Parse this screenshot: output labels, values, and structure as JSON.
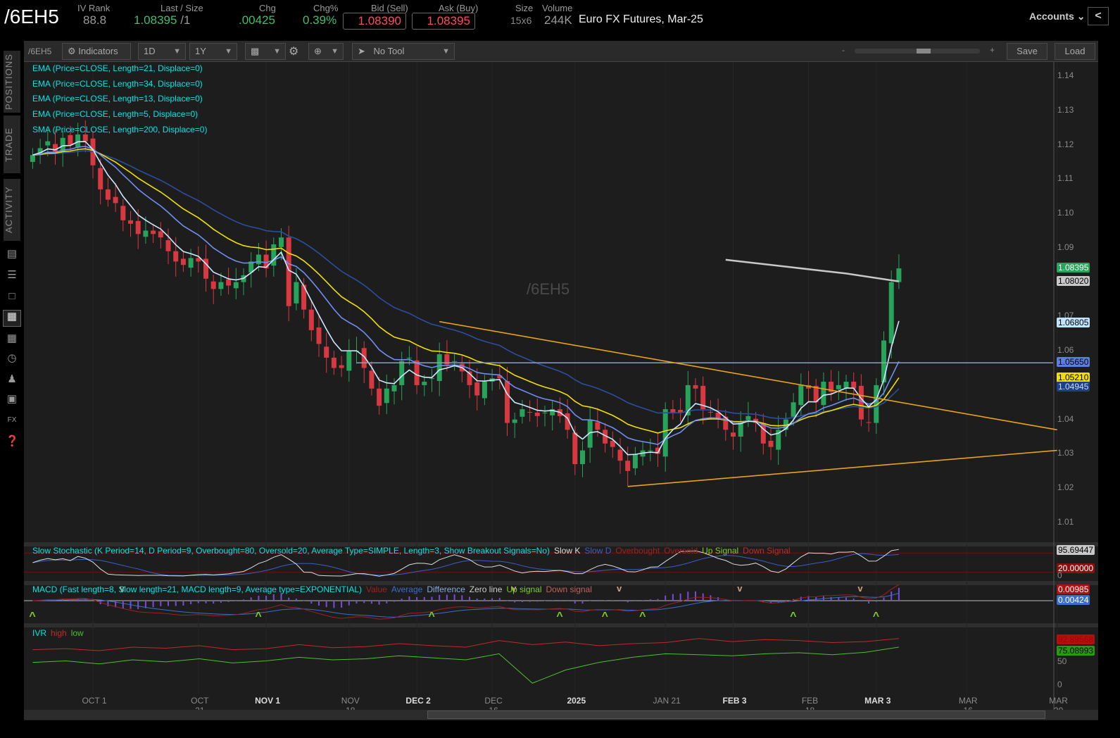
{
  "header": {
    "symbol": "/6EH5",
    "iv_rank_label": "IV Rank",
    "iv_rank": "88.8",
    "last_label": "Last / Size",
    "last": "1.08395",
    "size": "/1",
    "chg_label": "Chg",
    "chg": ".00425",
    "chgpct_label": "Chg%",
    "chgpct": "0.39%",
    "bid_label": "Bid (Sell)",
    "bid": "1.08390",
    "ask_label": "Ask (Buy)",
    "ask": "1.08395",
    "size_label": "Size",
    "size_val": "15x6",
    "volume_label": "Volume",
    "volume": "244K",
    "description": "Euro FX Futures, Mar-25",
    "accounts": "Accounts"
  },
  "toolbar": {
    "symbol": "/6EH5",
    "indicators": "Indicators",
    "aggregation": "1D",
    "timeframe": "1Y",
    "tool": "No Tool",
    "zoom_minus": "-",
    "zoom_plus": "+",
    "zoom_fraction": 0.55,
    "save": "Save",
    "load": "Load"
  },
  "sidebar": {
    "tabs": [
      "POSITIONS",
      "TRADE",
      "ACTIVITY"
    ],
    "icons": [
      "monitor-icon",
      "list-icon",
      "tv-icon",
      "chart-grid-icon",
      "grid-icon",
      "gauge-icon",
      "people-icon",
      "calendar-icon",
      "fx-icon",
      "help-icon"
    ]
  },
  "studies": [
    "EMA (Price=CLOSE, Length=21, Displace=0)",
    "EMA (Price=CLOSE, Length=34, Displace=0)",
    "EMA (Price=CLOSE, Length=13, Displace=0)",
    "EMA (Price=CLOSE, Length=5, Displace=0)",
    "SMA (Price=CLOSE, Length=200, Displace=0)"
  ],
  "watermark": "/6EH5",
  "colors": {
    "up": "#27a35a",
    "down": "#d8383f",
    "ema21": "#f0e000",
    "ema34": "#2a4f9e",
    "ema13": "#6f8ff0",
    "ema5": "#cde9ff",
    "sma200": "#c8c8c8",
    "trend": "#e8a317",
    "hline": "#8aa0c8"
  },
  "chart_data": {
    "type": "candlestick",
    "title": "/6EH5 Daily",
    "ylim": [
      1.005,
      1.145
    ],
    "yticks": [
      "1.01",
      "1.02",
      "1.03",
      "1.04",
      "1.05",
      "1.06",
      "1.07",
      "1.08",
      "1.09",
      "1.10",
      "1.11",
      "1.12",
      "1.13",
      "1.14"
    ],
    "xticks": [
      {
        "label": "OCT 1",
        "i": 8
      },
      {
        "label": "OCT 21",
        "i": 22
      },
      {
        "label": "NOV 1",
        "i": 31
      },
      {
        "label": "NOV 18",
        "i": 42
      },
      {
        "label": "DEC 2",
        "i": 51
      },
      {
        "label": "DEC 16",
        "i": 61
      },
      {
        "label": "2025",
        "i": 72
      },
      {
        "label": "JAN 21",
        "i": 84
      },
      {
        "label": "FEB 3",
        "i": 93
      },
      {
        "label": "FEB 18",
        "i": 103
      },
      {
        "label": "MAR 3",
        "i": 112
      },
      {
        "label": "MAR 16",
        "i": 124
      },
      {
        "label": "MAR 30",
        "i": 136
      }
    ],
    "closes": [
      1.117,
      1.119,
      1.121,
      1.118,
      1.122,
      1.12,
      1.123,
      1.121,
      1.114,
      1.107,
      1.104,
      1.103,
      1.098,
      1.097,
      1.094,
      1.095,
      1.094,
      1.093,
      1.089,
      1.086,
      1.085,
      1.087,
      1.086,
      1.081,
      1.078,
      1.08,
      1.079,
      1.08,
      1.082,
      1.086,
      1.088,
      1.084,
      1.091,
      1.093,
      1.073,
      1.08,
      1.072,
      1.066,
      1.062,
      1.058,
      1.055,
      1.055,
      1.06,
      1.06,
      1.055,
      1.049,
      1.044,
      1.049,
      1.05,
      1.057,
      1.058,
      1.05,
      1.051,
      1.052,
      1.059,
      1.056,
      1.057,
      1.054,
      1.05,
      1.047,
      1.051,
      1.052,
      1.052,
      1.039,
      1.04,
      1.043,
      1.042,
      1.041,
      1.042,
      1.043,
      1.041,
      1.037,
      1.027,
      1.031,
      1.04,
      1.037,
      1.033,
      1.032,
      1.028,
      1.025,
      1.03,
      1.031,
      1.031,
      1.03,
      1.043,
      1.042,
      1.042,
      1.05,
      1.049,
      1.043,
      1.042,
      1.04,
      1.037,
      1.035,
      1.039,
      1.041,
      1.039,
      1.033,
      1.032,
      1.037,
      1.04,
      1.045,
      1.05,
      1.049,
      1.045,
      1.051,
      1.048,
      1.05,
      1.051,
      1.049,
      1.04,
      1.039,
      1.05,
      1.063,
      1.08,
      1.084
    ],
    "sma200": [
      [
        92,
        1.0865
      ],
      [
        100,
        1.0845
      ],
      [
        108,
        1.0825
      ],
      [
        115,
        1.0802
      ]
    ],
    "hline": {
      "price": 1.0565,
      "from": 43
    },
    "trendlines": [
      {
        "from": [
          54,
          1.0685
        ],
        "to": [
          136,
          1.037
        ]
      },
      {
        "from": [
          79,
          1.0205
        ],
        "to": [
          136,
          1.031
        ]
      }
    ],
    "price_tags": [
      {
        "v": "1.08395",
        "bg": "#27a35a",
        "fg": "#fff",
        "p": 1.08395
      },
      {
        "v": "1.08020",
        "bg": "#c8c8c8",
        "fg": "#000",
        "p": 1.0802
      },
      {
        "v": "1.06805",
        "bg": "#bfe6ff",
        "fg": "#000",
        "p": 1.06805
      },
      {
        "v": "1.05650",
        "bg": "#5b7fe0",
        "fg": "#000",
        "p": 1.0565
      },
      {
        "v": "1.05210",
        "bg": "#f0e000",
        "fg": "#000",
        "p": 1.0521
      },
      {
        "v": "1.04945",
        "bg": "#1d3f8a",
        "fg": "#cde",
        "p": 1.04945
      }
    ]
  },
  "stochastic": {
    "title": "Slow Stochastic (K Period=14, D Period=9, Overbought=80, Oversold=20, Average Type=SIMPLE, Length=3, Show Breakout Signals=No)",
    "legend": [
      {
        "t": "Slow K",
        "c": "#ddd"
      },
      {
        "t": "Slow D",
        "c": "#3a5ec8"
      },
      {
        "t": "Overbought",
        "c": "#a02020"
      },
      {
        "t": "Oversold",
        "c": "#a02020"
      },
      {
        "t": "Up Signal",
        "c": "#7ccf1c"
      },
      {
        "t": "Down Signal",
        "c": "#c02a2a"
      }
    ],
    "tags": [
      {
        "v": "95.69447",
        "bg": "#c8c8c8",
        "fg": "#000"
      },
      {
        "v": "20.00000",
        "bg": "#8a1010",
        "fg": "#fff"
      }
    ],
    "axis": [
      "0"
    ]
  },
  "macd": {
    "title": "MACD (Fast length=8, Slow length=21, MACD length=9, Average type=EXPONENTIAL)",
    "legend": [
      {
        "t": "Value",
        "c": "#a02020"
      },
      {
        "t": "Average",
        "c": "#3a6ec8"
      },
      {
        "t": "Difference",
        "c": "#8ad"
      },
      {
        "t": "Zero line",
        "c": "#ccc"
      },
      {
        "t": "Up signal",
        "c": "#7ccf1c"
      },
      {
        "t": "Down signal",
        "c": "#c06060"
      }
    ],
    "tags": [
      {
        "v": "0.00985",
        "bg": "#b01010",
        "fg": "#fff"
      },
      {
        "v": "0.00424",
        "bg": "#3a6ec8",
        "fg": "#fff"
      }
    ],
    "up_signals": [
      0,
      30,
      53,
      70,
      76,
      81,
      101,
      112
    ],
    "down_signals": [
      12,
      64,
      78,
      94,
      110
    ]
  },
  "ivr": {
    "title": "IVR",
    "legend": [
      {
        "t": "high",
        "c": "#c02a2a"
      },
      {
        "t": "low",
        "c": "#4cc02a"
      }
    ],
    "tags": [
      {
        "v": "92.89568",
        "bg": "#b01010",
        "fg": "#a00"
      },
      {
        "v": "75.08993",
        "bg": "#2a9a10",
        "fg": "#000"
      }
    ],
    "axis": [
      "50",
      "0"
    ],
    "high": [
      70,
      72,
      68,
      75,
      73,
      78,
      70,
      72,
      80,
      74,
      76,
      82,
      78,
      75,
      88,
      80,
      85,
      78,
      82,
      84,
      92,
      86,
      90,
      88,
      84,
      86,
      92
    ],
    "low": [
      45,
      48,
      42,
      50,
      46,
      52,
      44,
      48,
      55,
      50,
      52,
      58,
      54,
      50,
      62,
      4,
      30,
      45,
      55,
      62,
      60,
      58,
      62,
      64,
      60,
      65,
      75
    ]
  }
}
